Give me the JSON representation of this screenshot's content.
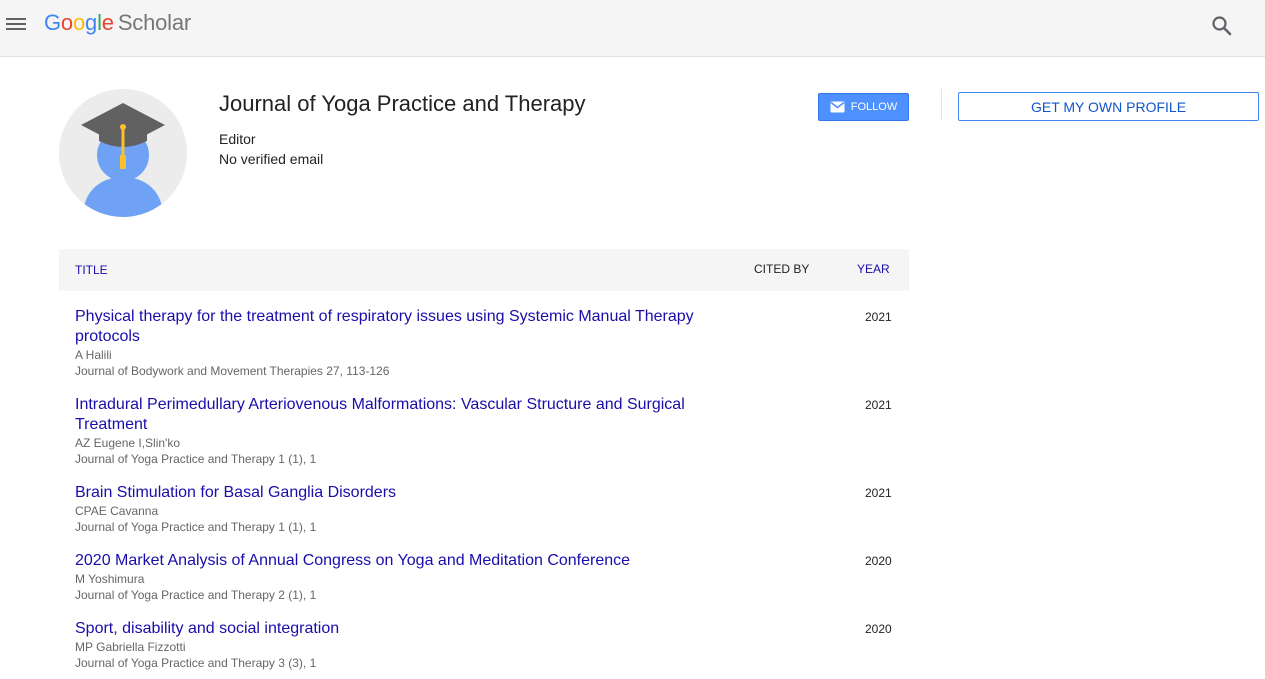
{
  "header": {
    "logo_google": [
      "G",
      "o",
      "o",
      "g",
      "l",
      "e"
    ],
    "logo_product": "Scholar",
    "menu_icon": "hamburger-menu-icon",
    "search_icon": "search-icon"
  },
  "profile": {
    "name": "Journal of Yoga Practice and Therapy",
    "affiliation": "Editor",
    "email": "No verified email",
    "follow_label": "FOLLOW",
    "own_profile_label": "GET MY OWN PROFILE",
    "colors": {
      "follow_bg": "#4d90fe",
      "avatar_body": "#6fa1f5",
      "cap": "#616161",
      "tassel": "#fbc02d"
    }
  },
  "table": {
    "col_title": "TITLE",
    "col_cited": "CITED BY",
    "col_year": "YEAR",
    "rows": [
      {
        "title": "Physical therapy for the treatment of respiratory issues using Systemic Manual Therapy protocols",
        "authors": "A Halili",
        "venue": "Journal of Bodywork and Movement Therapies 27, 113-126",
        "year": "2021"
      },
      {
        "title": "Intradural Perimedullary Arteriovenous Malformations: Vascular Structure and Surgical Treatment",
        "authors": "AZ Eugene I,Slin'ko",
        "venue": "Journal of Yoga Practice and Therapy 1 (1), 1",
        "year": "2021"
      },
      {
        "title": "Brain Stimulation for Basal Ganglia Disorders",
        "authors": "CPAE Cavanna",
        "venue": "Journal of Yoga Practice and Therapy 1 (1), 1",
        "year": "2021"
      },
      {
        "title": "2020 Market Analysis of Annual Congress on Yoga and Meditation Conference",
        "authors": "M Yoshimura",
        "venue": "Journal of Yoga Practice and Therapy 2 (1), 1",
        "year": "2020"
      },
      {
        "title": "Sport, disability and social integration",
        "authors": "MP Gabriella Fizzotti",
        "venue": "Journal of Yoga Practice and Therapy 3 (3), 1",
        "year": "2020"
      }
    ]
  }
}
